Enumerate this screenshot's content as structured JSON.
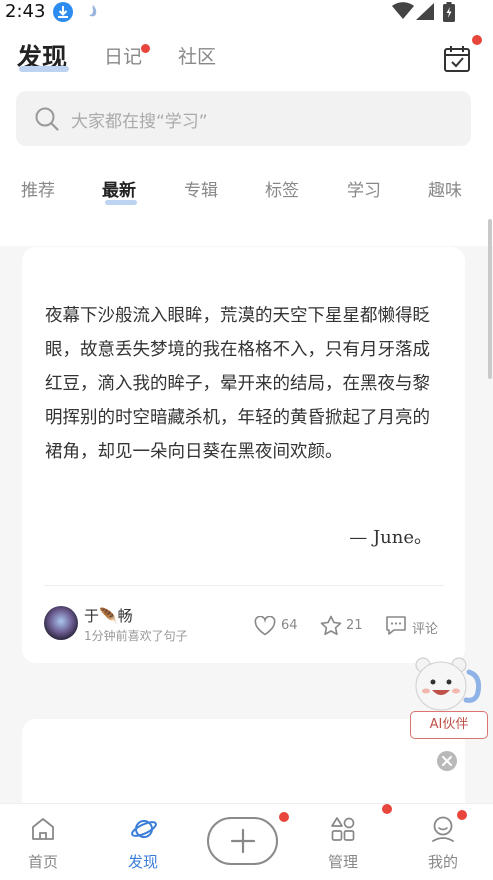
{
  "status_bar": {
    "time": "2:43"
  },
  "header": {
    "tabs": [
      {
        "label": "发现",
        "active": true
      },
      {
        "label": "日记",
        "has_dot": true
      },
      {
        "label": "社区"
      }
    ],
    "calendar_icon": "calendar-check-icon"
  },
  "search": {
    "placeholder": "大家都在搜“学习”"
  },
  "categories": [
    "推荐",
    "最新",
    "专辑",
    "标签",
    "学习",
    "趣味"
  ],
  "active_category": "最新",
  "post": {
    "content": "夜幕下沙般流入眼眸，荒漠的天空下星星都懒得眨眼，故意丢失梦境的我在格格不入，只有月牙落成红豆，滴入我的眸子，晕开来的结局，在黑夜与黎明挥别的时空暗藏杀机，年轻的黄昏掀起了月亮的裙角，却见一朵向日葵在黑夜间欢颜。",
    "signature": "— June。",
    "author": "于🪶畅",
    "activity": "1分钟前喜欢了句子",
    "likes": "64",
    "favorites": "21",
    "comment_label": "评论"
  },
  "ai_assistant": {
    "label": "AI伙伴"
  },
  "bottom_nav": [
    {
      "label": "首页",
      "icon": "home-icon"
    },
    {
      "label": "发现",
      "icon": "planet-icon",
      "active": true
    },
    {
      "label": "",
      "icon": "plus-icon"
    },
    {
      "label": "管理",
      "icon": "grid-icon"
    },
    {
      "label": "我的",
      "icon": "profile-icon"
    }
  ],
  "colors": {
    "accent": "#3b7ed8",
    "badge": "#e8453c",
    "underline": "#bcd4f2"
  }
}
